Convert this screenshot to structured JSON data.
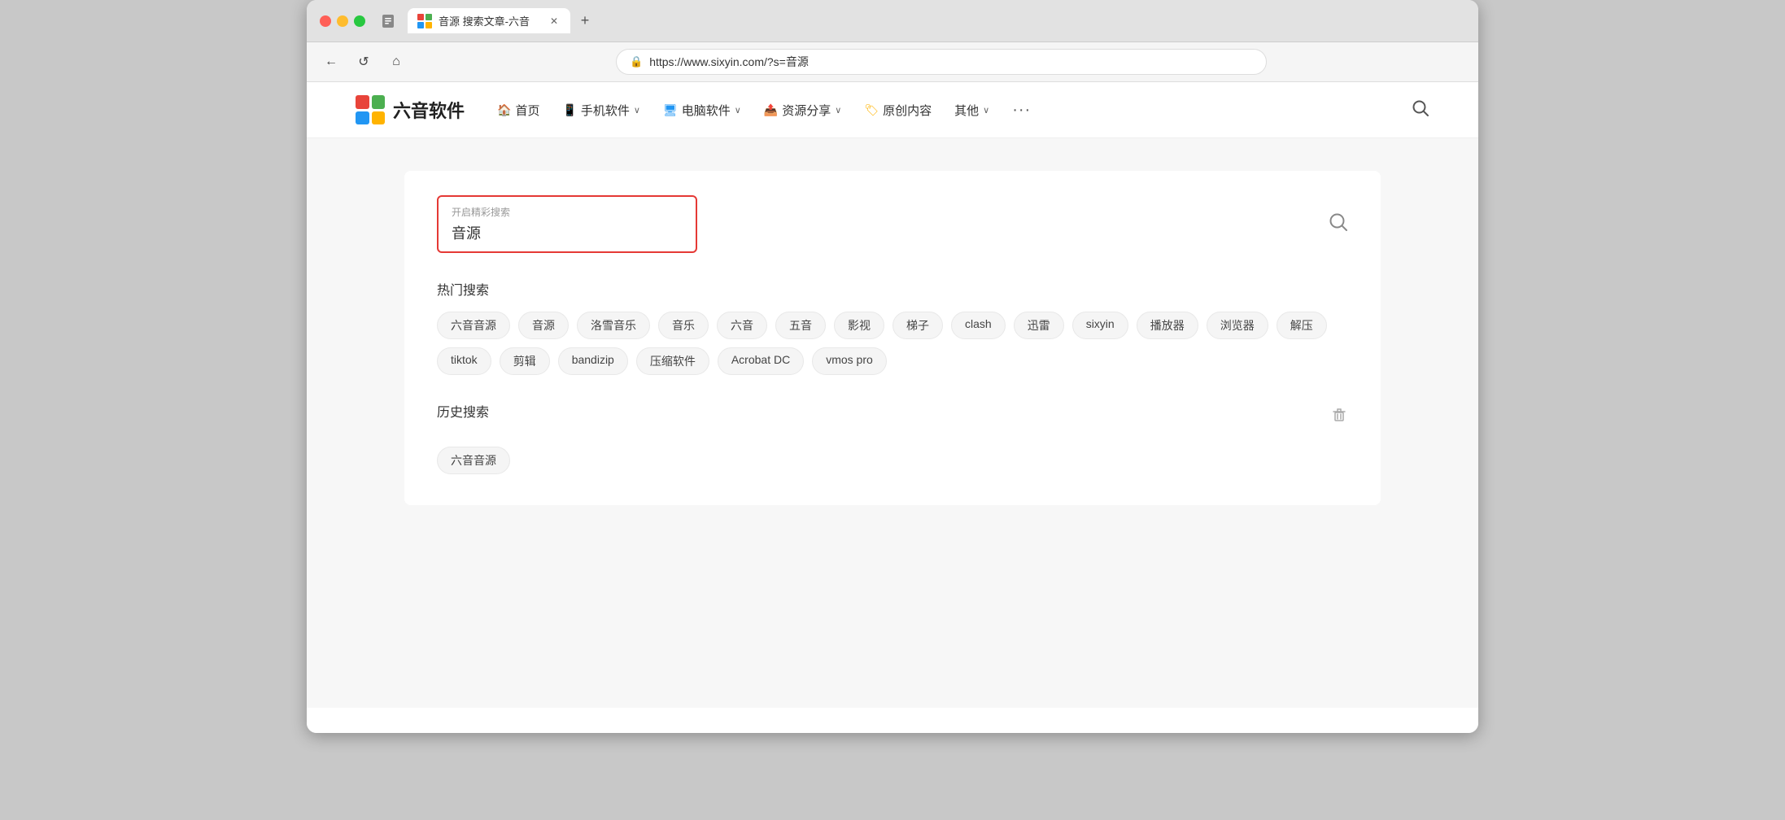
{
  "browser": {
    "tab_title": "音源 搜索文章-六音",
    "url": "https://www.sixyin.com/?s=音源",
    "new_tab_label": "+"
  },
  "nav": {
    "back_label": "←",
    "refresh_label": "↺",
    "home_label": "⌂"
  },
  "site": {
    "logo_text": "六音软件",
    "nav_items": [
      {
        "icon": "🏠",
        "label": "首页",
        "has_dropdown": false
      },
      {
        "icon": "📱",
        "label": "手机软件",
        "has_dropdown": true
      },
      {
        "icon": "🖥",
        "label": "电脑软件",
        "has_dropdown": true
      },
      {
        "icon": "📤",
        "label": "资源分享",
        "has_dropdown": true
      },
      {
        "icon": "🏷",
        "label": "原创内容",
        "has_dropdown": false
      },
      {
        "label": "其他",
        "has_dropdown": true
      }
    ],
    "more_label": "···"
  },
  "search": {
    "hint": "开启精彩搜索",
    "value": "音源",
    "submit_icon": "🔍"
  },
  "hot_search": {
    "title": "热门搜索",
    "tags": [
      "六音音源",
      "音源",
      "洛雪音乐",
      "音乐",
      "六音",
      "五音",
      "影视",
      "梯子",
      "clash",
      "迅雷",
      "sixyin",
      "播放器",
      "浏览器",
      "解压",
      "tiktok",
      "剪辑",
      "bandizip",
      "压缩软件",
      "Acrobat DC",
      "vmos pro"
    ]
  },
  "history_search": {
    "title": "历史搜索",
    "tags": [
      "六音音源"
    ]
  },
  "colors": {
    "search_border": "#e53935",
    "accent_red": "#e8443a",
    "accent_green": "#4caf50",
    "accent_blue": "#2196f3",
    "accent_yellow": "#ffb300"
  }
}
